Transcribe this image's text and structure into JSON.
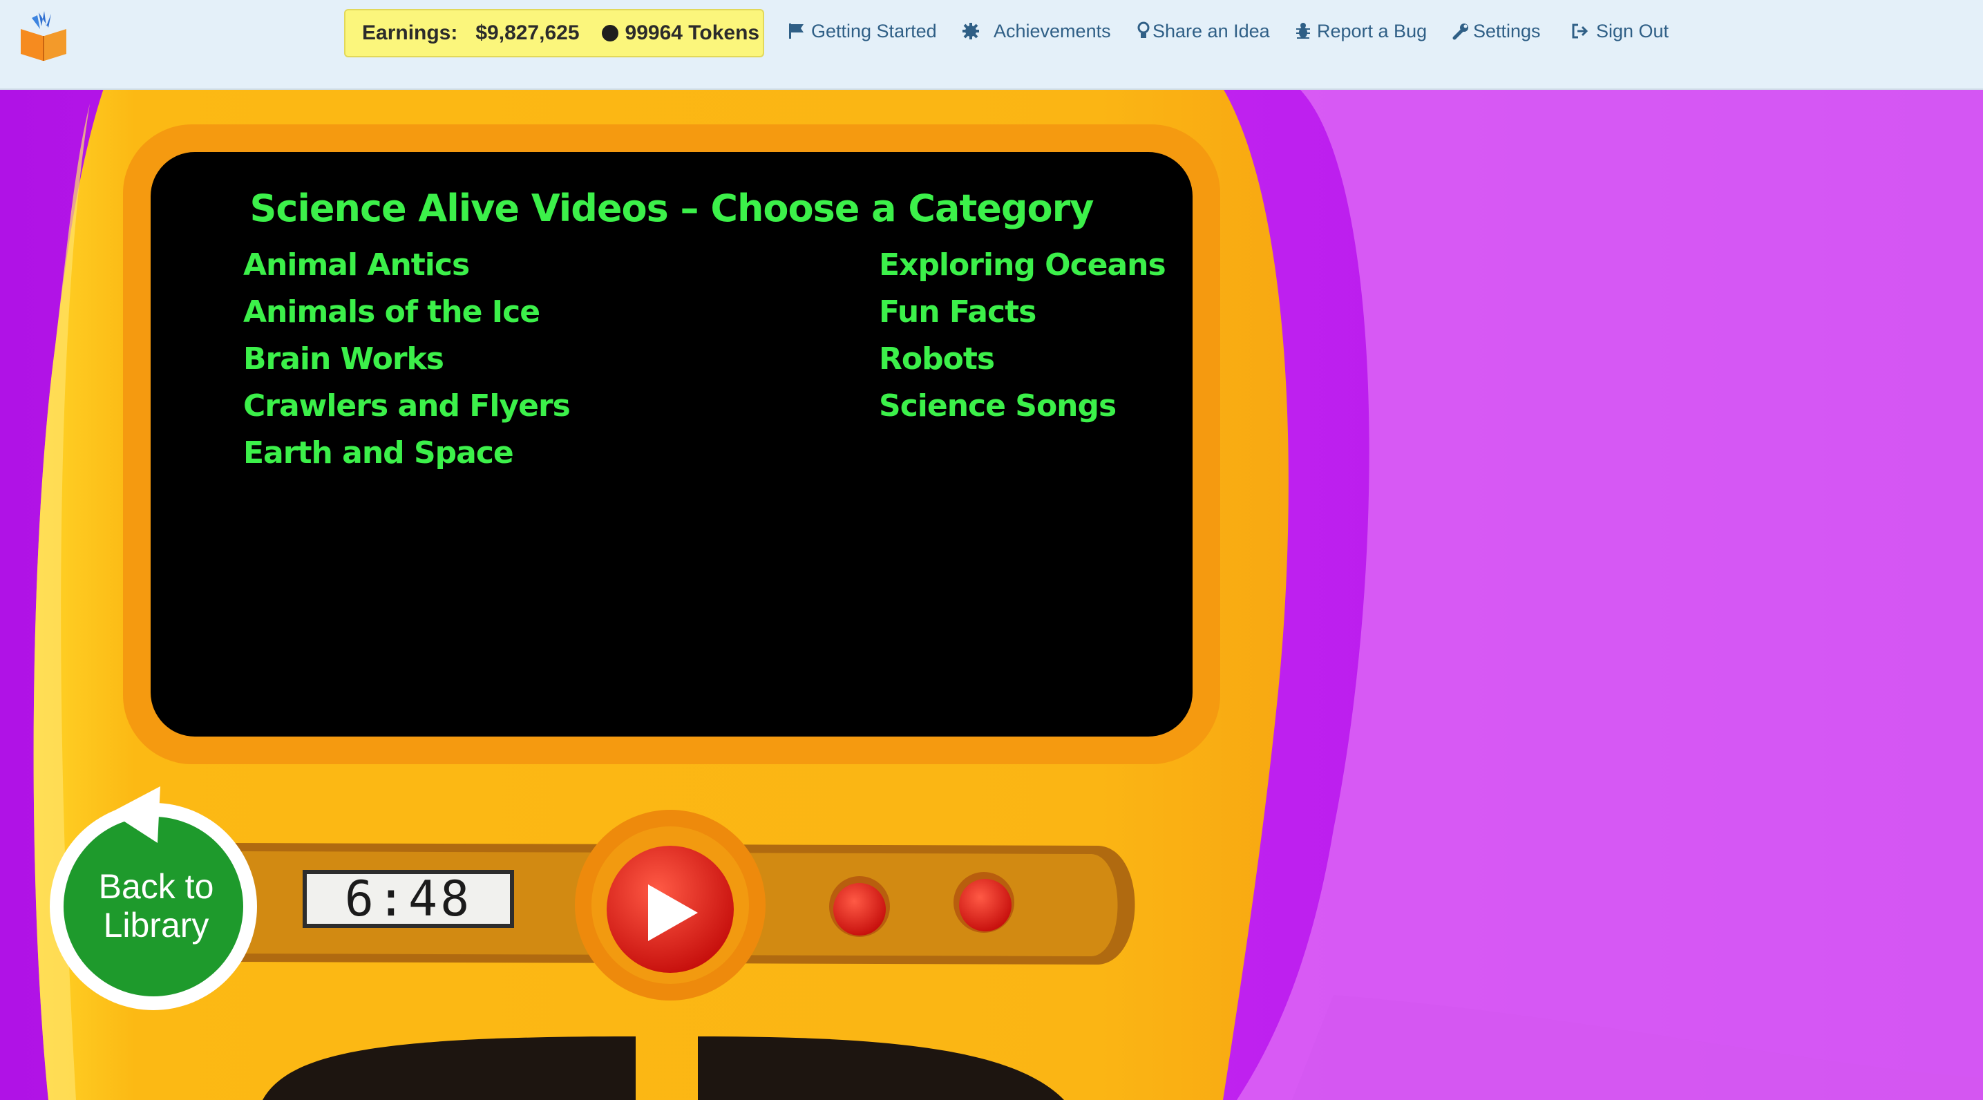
{
  "header": {
    "earnings_label": "Earnings:",
    "earnings_value": "$9,827,625",
    "tokens": "99964 Tokens"
  },
  "nav": {
    "getting_started": "Getting Started",
    "achievements": "Achievements",
    "share_idea": "Share an Idea",
    "report_bug": "Report a Bug",
    "settings": "Settings",
    "sign_out": "Sign Out"
  },
  "screen": {
    "title": "Science Alive Videos – Choose a Category",
    "categories_left": [
      "Animal Antics",
      "Animals of the Ice",
      "Brain Works",
      "Crawlers and Flyers",
      "Earth and Space"
    ],
    "categories_right": [
      "Exploring Oceans",
      "Fun Facts",
      "Robots",
      "Science Songs"
    ]
  },
  "controls": {
    "counter": "6:48",
    "back_label_line1": "Back to",
    "back_label_line2": "Library"
  },
  "colors": {
    "screen_text": "#3cf04a",
    "machine": "#fbb417",
    "background": "#b419e8",
    "nav_link": "#2f5f86"
  },
  "icons": [
    "book-logo-icon",
    "flag-icon",
    "gear-icon",
    "lightbulb-icon",
    "bug-icon",
    "wrench-icon",
    "sign-out-icon",
    "play-icon",
    "back-arrow-icon"
  ]
}
